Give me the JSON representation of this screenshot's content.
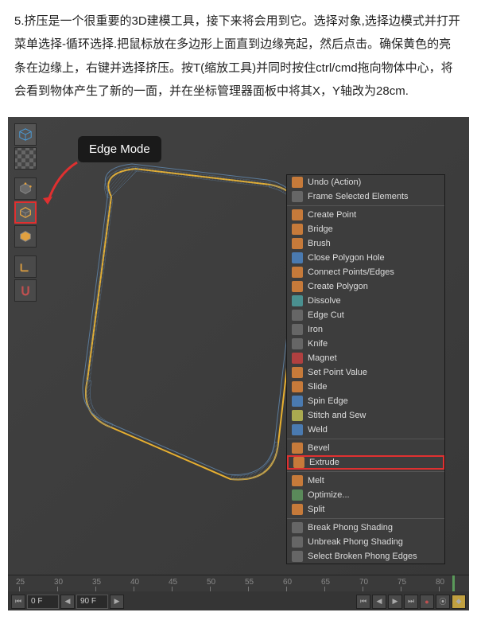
{
  "tutorial": {
    "text": "5.挤压是一个很重要的3D建模工具，接下来将会用到它。选择对象,选择边模式并打开菜单选择-循环选择.把鼠标放在多边形上面直到边缘亮起，然后点击。确保黄色的亮条在边缘上，右键并选择挤压。按T(缩放工具)并同时按住ctrl/cmd拖向物体中心，将会看到物体产生了新的一面，并在坐标管理器面板中将其X，Y轴改为28cm."
  },
  "tooltip": {
    "label": "Edge Mode"
  },
  "context_menu": [
    {
      "icon": "orange",
      "label": "Undo (Action)"
    },
    {
      "icon": "gray",
      "label": "Frame Selected Elements"
    },
    {
      "sep": true
    },
    {
      "icon": "orange",
      "label": "Create Point"
    },
    {
      "icon": "orange",
      "label": "Bridge"
    },
    {
      "icon": "orange",
      "label": "Brush"
    },
    {
      "icon": "blue",
      "label": "Close Polygon Hole"
    },
    {
      "icon": "orange",
      "label": "Connect Points/Edges"
    },
    {
      "icon": "orange",
      "label": "Create Polygon"
    },
    {
      "icon": "teal",
      "label": "Dissolve"
    },
    {
      "icon": "gray",
      "label": "Edge Cut"
    },
    {
      "icon": "gray",
      "label": "Iron"
    },
    {
      "icon": "gray",
      "label": "Knife"
    },
    {
      "icon": "red",
      "label": "Magnet"
    },
    {
      "icon": "orange",
      "label": "Set Point Value"
    },
    {
      "icon": "orange",
      "label": "Slide"
    },
    {
      "icon": "blue",
      "label": "Spin Edge"
    },
    {
      "icon": "yellow",
      "label": "Stitch and Sew"
    },
    {
      "icon": "blue",
      "label": "Weld"
    },
    {
      "sep": true
    },
    {
      "icon": "orange",
      "label": "Bevel"
    },
    {
      "icon": "orange",
      "label": "Extrude",
      "highlight": true
    },
    {
      "sep": true
    },
    {
      "icon": "orange",
      "label": "Melt"
    },
    {
      "icon": "green",
      "label": "Optimize..."
    },
    {
      "icon": "orange",
      "label": "Split"
    },
    {
      "sep": true
    },
    {
      "icon": "gray",
      "label": "Break Phong Shading"
    },
    {
      "icon": "gray",
      "label": "Unbreak Phong Shading"
    },
    {
      "icon": "gray",
      "label": "Select Broken Phong Edges"
    }
  ],
  "timeline": {
    "ticks": [
      "25",
      "30",
      "35",
      "40",
      "45",
      "50",
      "55",
      "60",
      "65",
      "70",
      "75",
      "80"
    ],
    "frame_start": "0 F",
    "frame_end": "90 F"
  }
}
